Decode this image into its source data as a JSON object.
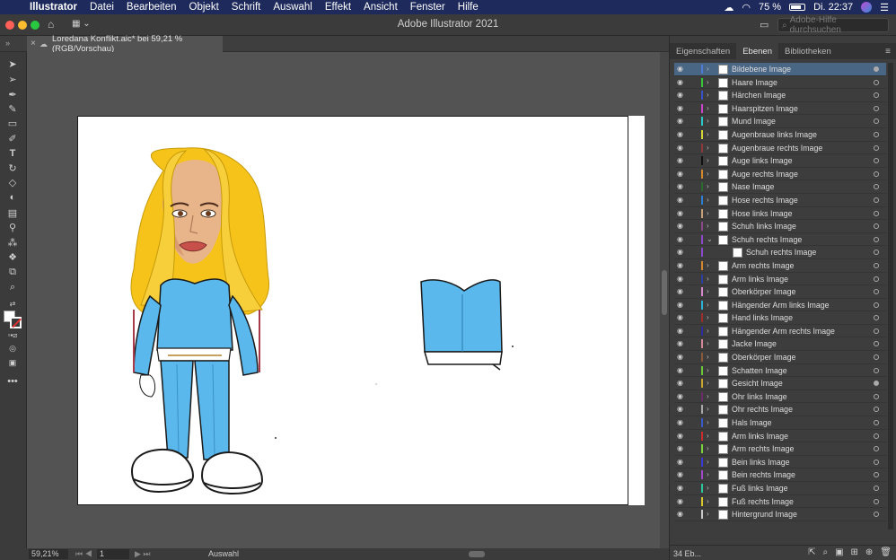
{
  "menubar": {
    "apple": "",
    "app": "Illustrator",
    "items": [
      "Datei",
      "Bearbeiten",
      "Objekt",
      "Schrift",
      "Auswahl",
      "Effekt",
      "Ansicht",
      "Fenster",
      "Hilfe"
    ],
    "battery": "75 %",
    "clock": "Di. 22:37"
  },
  "window": {
    "title": "Adobe Illustrator 2021",
    "search_placeholder": "Adobe-Hilfe durchsuchen"
  },
  "document_tab": {
    "label": "Loredana Konflikt.aic* bei 59,21 % (RGB/Vorschau)"
  },
  "status": {
    "zoom": "59,21%",
    "page": "1",
    "mode": "Auswahl"
  },
  "panel": {
    "tabs": [
      "Eigenschaften",
      "Ebenen",
      "Bibliotheken"
    ],
    "active_tab": "Ebenen",
    "layer_count": "34 Eb...",
    "layers": [
      {
        "name": "Bildebene Image",
        "color": "#4f7bd6",
        "selected": true,
        "target_filled": true
      },
      {
        "name": "Haare Image",
        "color": "#37c837"
      },
      {
        "name": "Härchen Image",
        "color": "#3b53c9"
      },
      {
        "name": "Haarspitzen Image",
        "color": "#c945c9"
      },
      {
        "name": "Mund Image",
        "color": "#2dc8c8"
      },
      {
        "name": "Augenbraue links Image",
        "color": "#d6d63a"
      },
      {
        "name": "Augenbraue rechts Image",
        "color": "#8a3a3a"
      },
      {
        "name": "Auge links Image",
        "color": "#111111"
      },
      {
        "name": "Auge rechts Image",
        "color": "#d48a2d"
      },
      {
        "name": "Nase Image",
        "color": "#2d6a2d"
      },
      {
        "name": "Hose rechts Image",
        "color": "#2d7fd6"
      },
      {
        "name": "Hose links Image",
        "color": "#c8a07a"
      },
      {
        "name": "Schuh links Image",
        "color": "#8a4a8a"
      },
      {
        "name": "Schuh rechts Image",
        "color": "#8a4ac9",
        "expanded": true
      },
      {
        "name": "Schuh rechts Image",
        "color": "#8a4ac9",
        "child": true
      },
      {
        "name": "Arm rechts Image",
        "color": "#d6892d"
      },
      {
        "name": "Arm links Image",
        "color": "#2d3fa0"
      },
      {
        "name": "Oberkörper Image",
        "color": "#d68ac9"
      },
      {
        "name": "Hängender Arm links Image",
        "color": "#2db3d6"
      },
      {
        "name": "Hand links Image",
        "color": "#a02d2d"
      },
      {
        "name": "Hängender Arm rechts Image",
        "color": "#2d2da0"
      },
      {
        "name": "Jacke Image",
        "color": "#d6899a"
      },
      {
        "name": "Oberkörper Image",
        "color": "#8a5a3a"
      },
      {
        "name": "Schatten Image",
        "color": "#6ac93a"
      },
      {
        "name": "Gesicht Image",
        "color": "#c9a82d",
        "target_filled": true
      },
      {
        "name": "Ohr links Image",
        "color": "#6a2d6a"
      },
      {
        "name": "Ohr rechts Image",
        "color": "#aaaaaa"
      },
      {
        "name": "Hals Image",
        "color": "#3a5ac9"
      },
      {
        "name": "Arm links Image",
        "color": "#c92d2d"
      },
      {
        "name": "Arm rechts Image",
        "color": "#7ad63a"
      },
      {
        "name": "Bein links Image",
        "color": "#3a3ad6"
      },
      {
        "name": "Bein rechts Image",
        "color": "#a04ac9"
      },
      {
        "name": "Fuß links Image",
        "color": "#2dc8a0"
      },
      {
        "name": "Fuß rechts Image",
        "color": "#d6c82d"
      },
      {
        "name": "Hintergrund Image",
        "color": "#c9c9c9"
      }
    ]
  }
}
